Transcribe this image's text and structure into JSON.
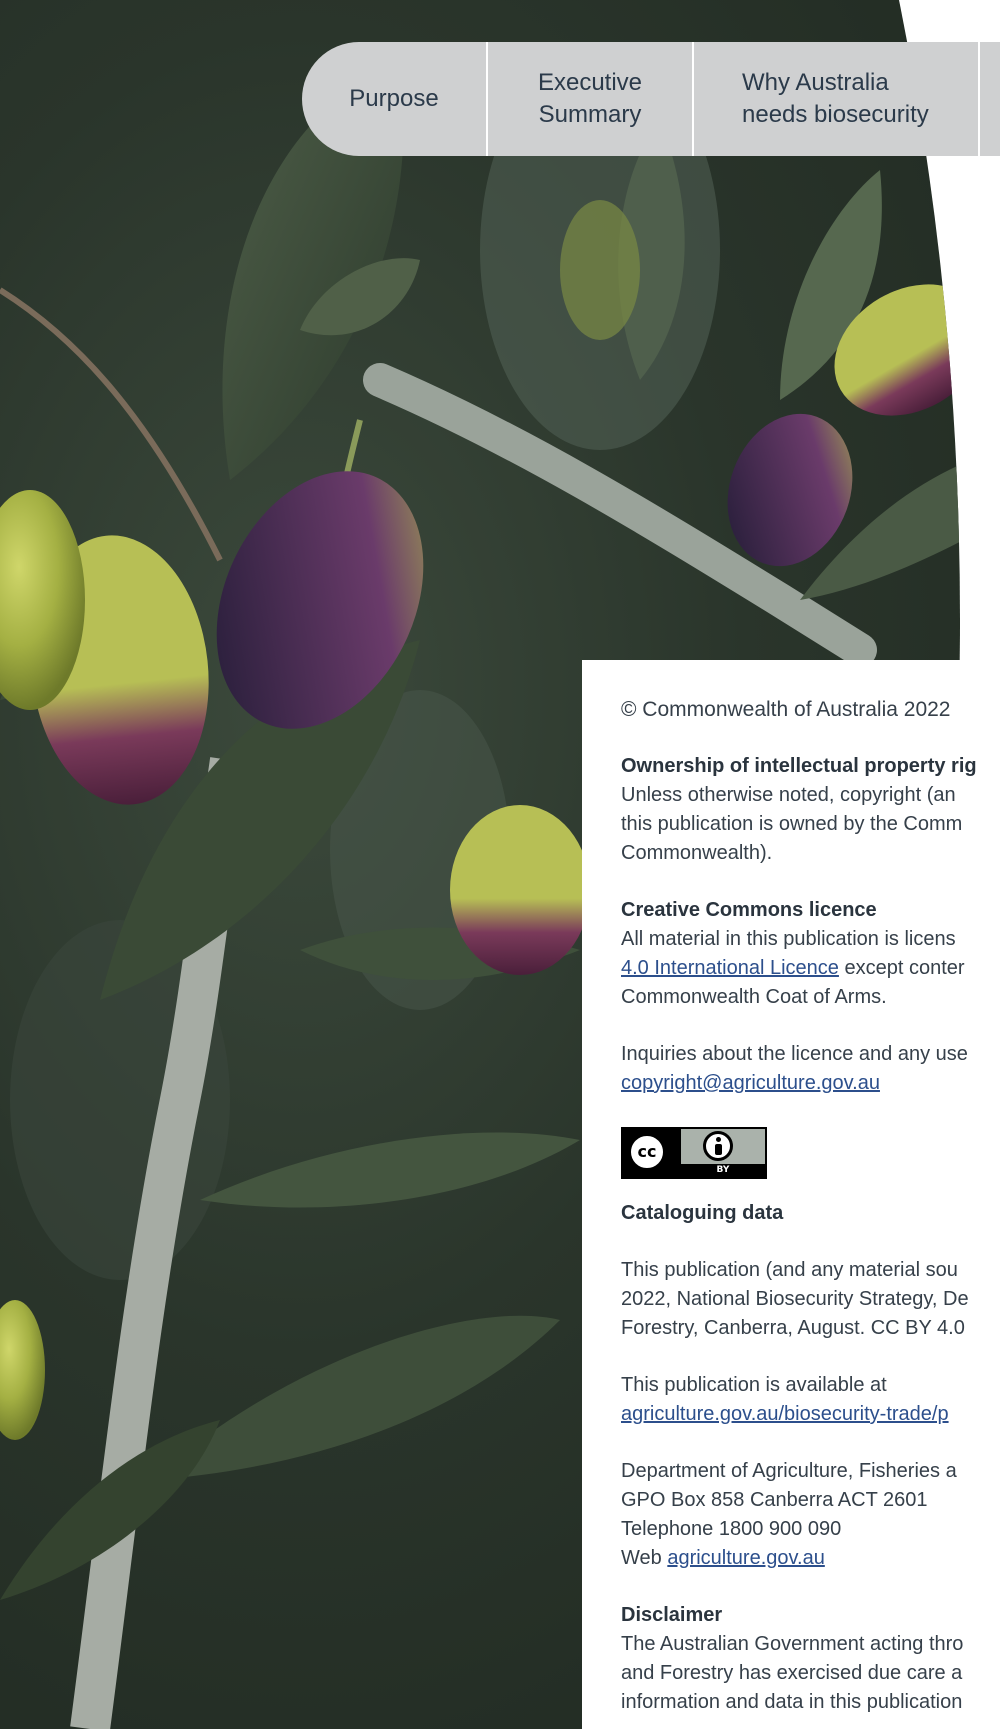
{
  "nav": {
    "tabs": [
      {
        "label": "Purpose"
      },
      {
        "label": "Executive\nSummary"
      },
      {
        "label": "Why Australia\nneeds biosecurity"
      },
      {
        "label": ""
      }
    ]
  },
  "colors": {
    "nav_background": "#cfd0d1",
    "nav_text": "#2b3a4a",
    "link": "#2c4f8c",
    "body_text": "#36404a"
  },
  "copyright": {
    "line": "© Commonwealth of Australia 2022",
    "ownership_heading": "Ownership of intellectual property rig",
    "ownership_lines": [
      "Unless otherwise noted, copyright (an",
      "this publication is owned by the Comm",
      "Commonwealth)."
    ],
    "cc_heading": "Creative Commons licence",
    "cc_line1": "All material in this publication is licens",
    "cc_link": "4.0 International Licence",
    "cc_line2_rest": " except conter",
    "cc_line3": "Commonwealth Coat of Arms.",
    "inquiries_line": "Inquiries about the licence and any use",
    "inquiries_email": "copyright@agriculture.gov.au",
    "badge": {
      "cc": "cc",
      "by": "BY"
    },
    "cataloguing_heading": "Cataloguing data",
    "cataloguing_lines": [
      "This publication (and any material sou",
      "2022, National Biosecurity Strategy, De",
      "Forestry, Canberra, August. CC BY 4.0"
    ],
    "available_line": "This publication is available at",
    "available_link": "agriculture.gov.au/biosecurity-trade/p",
    "dept_lines": [
      "Department of Agriculture, Fisheries a",
      "GPO Box 858 Canberra ACT 2601",
      "Telephone 1800 900 090"
    ],
    "web_label": "Web ",
    "web_link": "agriculture.gov.au",
    "disclaimer_heading": "Disclaimer",
    "disclaimer_lines": [
      "The Australian Government acting thro",
      "and Forestry has exercised due care a",
      "information and data in this publication"
    ]
  }
}
